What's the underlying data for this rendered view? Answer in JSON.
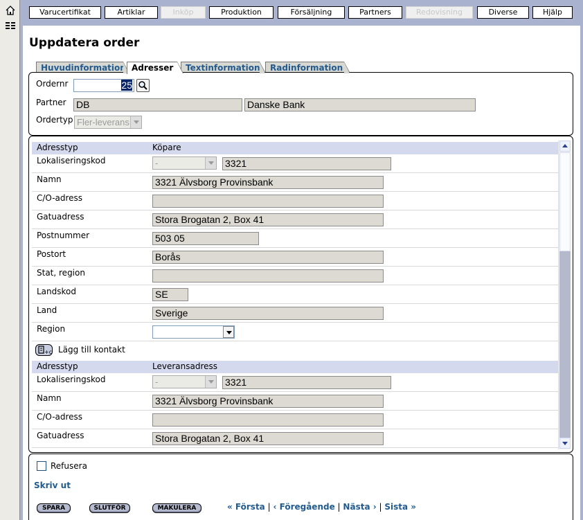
{
  "nav": {
    "items": [
      {
        "label": "Varucertifikat",
        "enabled": true
      },
      {
        "label": "Artiklar",
        "enabled": true
      },
      {
        "label": "Inköp",
        "enabled": false
      },
      {
        "label": "Produktion",
        "enabled": true
      },
      {
        "label": "Försäljning",
        "enabled": true
      },
      {
        "label": "Partners",
        "enabled": true
      },
      {
        "label": "Redovisning",
        "enabled": false
      },
      {
        "label": "Diverse",
        "enabled": true
      },
      {
        "label": "Hjälp",
        "enabled": true
      }
    ]
  },
  "sidebar": {
    "icons": [
      "home-icon",
      "list-icon"
    ]
  },
  "page": {
    "title": "Uppdatera order"
  },
  "tabs": [
    {
      "label": "Huvudinformation",
      "active": false
    },
    {
      "label": "Adresser",
      "active": true
    },
    {
      "label": "Textinformation",
      "active": false
    },
    {
      "label": "Radinformation",
      "active": false
    }
  ],
  "header_form": {
    "ordernr_label": "Ordernr",
    "ordernr_value": "25",
    "partner_label": "Partner",
    "partner_code": "DB",
    "partner_name": "Danske Bank",
    "ordertyp_label": "Ordertyp",
    "ordertyp_value": "Fler-leverans"
  },
  "addresses": {
    "buyer": {
      "adresstyp_label": "Adresstyp",
      "adresstyp_value": "Köpare",
      "lokaliseringskod_label": "Lokaliseringskod",
      "lokaliseringskod_select": "-",
      "lokaliseringskod_value": "3321",
      "namn_label": "Namn",
      "namn_value": "3321 Älvsborg Provinsbank",
      "co_label": "C/O-adress",
      "co_value": "",
      "gatuadress_label": "Gatuadress",
      "gatuadress_value": "Stora Brogatan 2, Box 41",
      "postnummer_label": "Postnummer",
      "postnummer_value": "503 05",
      "postort_label": "Postort",
      "postort_value": "Borås",
      "stat_label": "Stat, region",
      "stat_value": "",
      "landskod_label": "Landskod",
      "landskod_value": "SE",
      "land_label": "Land",
      "land_value": "Sverige",
      "region_label": "Region",
      "region_value": ""
    },
    "add_contact_label": "Lägg till kontakt",
    "delivery": {
      "adresstyp_label": "Adresstyp",
      "adresstyp_value": "Leveransadress",
      "lokaliseringskod_label": "Lokaliseringskod",
      "lokaliseringskod_select": "-",
      "lokaliseringskod_value": "3321",
      "namn_label": "Namn",
      "namn_value": "3321 Älvsborg Provinsbank",
      "co_label": "C/O-adress",
      "co_value": "",
      "gatuadress_label": "Gatuadress",
      "gatuadress_value": "Stora Brogatan 2, Box 41"
    }
  },
  "footer": {
    "refusera_label": "Refusera",
    "refusera_checked": false,
    "print_link": "Skriv ut",
    "buttons": {
      "spara": "SPARA",
      "slutfor": "SLUTFÖR",
      "makulera": "MAKULERA"
    },
    "pager": {
      "first": "« Första",
      "prev": "‹ Föregående",
      "next": "Nästa ›",
      "last": "Sista »",
      "sep": "|"
    }
  }
}
